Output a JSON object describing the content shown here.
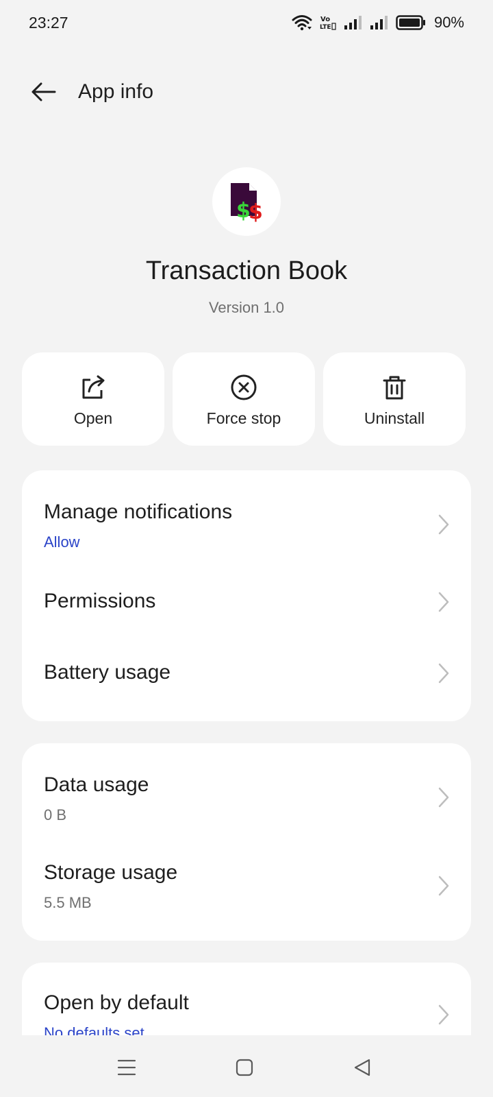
{
  "status_bar": {
    "time": "23:27",
    "battery_percent": "90%",
    "icons": [
      "wifi-icon",
      "volte-icon",
      "signal-icon",
      "signal-icon",
      "battery-icon"
    ]
  },
  "header": {
    "back_icon": "back-arrow-icon",
    "title": "App info"
  },
  "app": {
    "name": "Transaction Book",
    "version": "Version 1.0"
  },
  "actions": [
    {
      "label": "Open",
      "icon": "open-external-icon"
    },
    {
      "label": "Force stop",
      "icon": "force-stop-icon"
    },
    {
      "label": "Uninstall",
      "icon": "trash-icon"
    }
  ],
  "card1": {
    "notifications": {
      "title": "Manage notifications",
      "sub": "Allow"
    },
    "permissions": {
      "title": "Permissions"
    },
    "battery": {
      "title": "Battery usage"
    }
  },
  "card2": {
    "data": {
      "title": "Data usage",
      "sub": "0 B"
    },
    "storage": {
      "title": "Storage usage",
      "sub": "5.5 MB"
    }
  },
  "card3": {
    "open_default": {
      "title": "Open by default",
      "sub": "No defaults set"
    }
  },
  "colors": {
    "background": "#f3f3f3",
    "card": "#ffffff",
    "link_blue": "#2b44c8"
  },
  "nav": [
    "menu-icon",
    "home-icon",
    "back-icon"
  ]
}
